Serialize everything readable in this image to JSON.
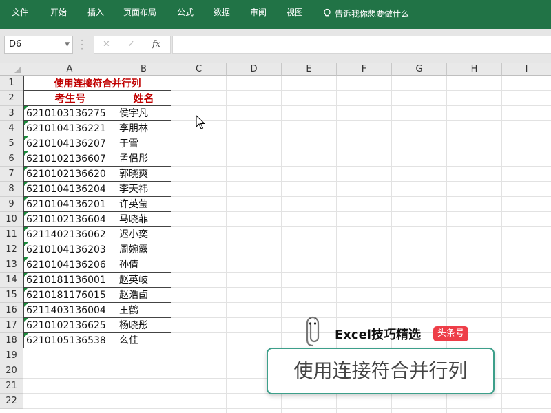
{
  "ribbon": {
    "tabs": [
      "文件",
      "开始",
      "插入",
      "页面布局",
      "公式",
      "数据",
      "审阅",
      "视图"
    ],
    "tell_me": "告诉我你想要做什么",
    "accent": "#217346"
  },
  "formula_bar": {
    "name_box": "D6",
    "fx": "fx",
    "formula": ""
  },
  "columns": [
    "A",
    "B",
    "C",
    "D",
    "E",
    "F",
    "G",
    "H",
    "I"
  ],
  "rows": [
    "1",
    "2",
    "3",
    "4",
    "5",
    "6",
    "7",
    "8",
    "9",
    "10",
    "11",
    "12",
    "13",
    "14",
    "15",
    "16",
    "17",
    "18",
    "19",
    "20",
    "21",
    "22"
  ],
  "sheet": {
    "title": "使用连接符合并行列",
    "header": {
      "a": "考生号",
      "b": "姓名"
    },
    "records": [
      [
        "6210103136275",
        "侯宇凡"
      ],
      [
        "6210104136221",
        "李朋林"
      ],
      [
        "6210104136207",
        "于雪"
      ],
      [
        "6210102136607",
        "孟侣彤"
      ],
      [
        "6210102136620",
        "郭晓爽"
      ],
      [
        "6210104136204",
        "李天祎"
      ],
      [
        "6210104136201",
        "许英莹"
      ],
      [
        "6210102136604",
        "马晓菲"
      ],
      [
        "6211402136062",
        "迟小奕"
      ],
      [
        "6210104136203",
        "周婉露"
      ],
      [
        "6210104136206",
        "孙倩"
      ],
      [
        "6210181136001",
        "赵英岐"
      ],
      [
        "6210181176015",
        "赵浩卣"
      ],
      [
        "6211403136004",
        "王鹤"
      ],
      [
        "6210102136625",
        "杨晓彤"
      ],
      [
        "6210105136538",
        "么佳"
      ]
    ],
    "header_color": "#c00000"
  },
  "watermark": {
    "brand": "Excel技巧精选",
    "badge": "头条号",
    "icon": "paperclip-icon"
  },
  "caption": "使用连接符合并行列"
}
